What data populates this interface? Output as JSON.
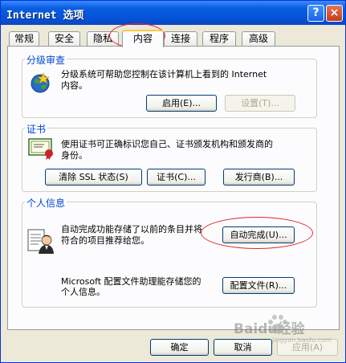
{
  "window": {
    "title": "Internet 选项",
    "help_glyph": "?",
    "close_glyph": "×"
  },
  "tabs": [
    {
      "label": "常规"
    },
    {
      "label": "安全"
    },
    {
      "label": "隐私"
    },
    {
      "label": "内容"
    },
    {
      "label": "连接"
    },
    {
      "label": "程序"
    },
    {
      "label": "高级"
    }
  ],
  "content_advisor": {
    "title": "分级审查",
    "description_line1": "分级系统可帮助您控制在该计算机上看到的 Internet",
    "description_line2": "内容。",
    "enable_button": "启用(E)...",
    "settings_button": "设置(T)...",
    "icon": "globe-icon"
  },
  "certificates": {
    "title": "证书",
    "description_line1": "使用证书可正确标识您自己、证书颁发机构和颁发商的",
    "description_line2": "身份。",
    "clear_ssl_button": "清除 SSL 状态(S)",
    "certificates_button": "证书(C)...",
    "publishers_button": "发行商(B)...",
    "icon": "certificate-icon"
  },
  "personal_info": {
    "title": "个人信息",
    "autocomplete_line1": "自动完成功能存储了以前的条目并将",
    "autocomplete_line2": "符合的项目推荐给您。",
    "autocomplete_button": "自动完成(U)...",
    "profile_line1": "Microsoft 配置文件助理能存储您的",
    "profile_line2": "个人信息。",
    "profile_button": "配置文件(R)...",
    "icon": "profile-card-icon"
  },
  "footer": {
    "ok_button": "确定",
    "cancel_button": "取消",
    "apply_button": "应用(A)"
  },
  "watermark": {
    "text": "Baidu经验",
    "sub": "jingyan.baidu.com"
  },
  "colors": {
    "accent": "#0046d5",
    "highlight_ellipse": "#e0262b",
    "titlebar": "#0354d8"
  }
}
